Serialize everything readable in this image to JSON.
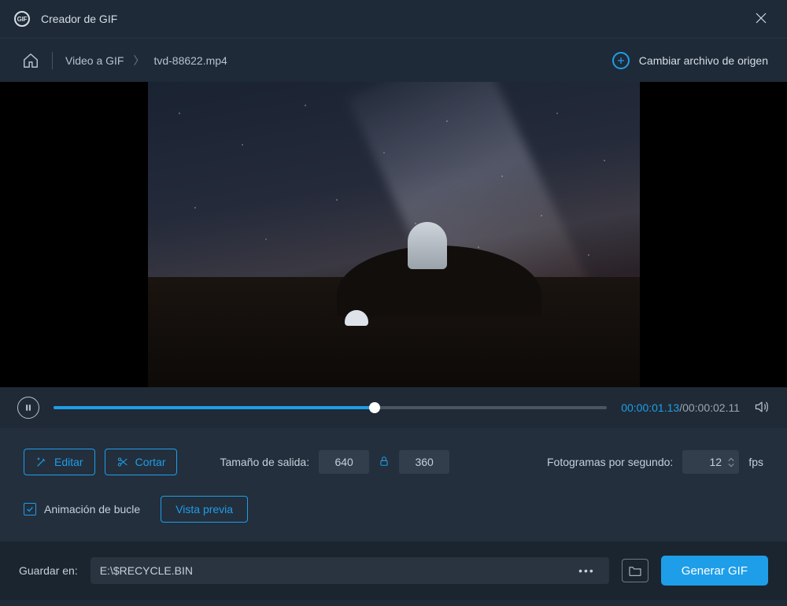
{
  "titlebar": {
    "app_title": "Creador de GIF"
  },
  "breadcrumb": {
    "section": "Video a GIF",
    "filename": "tvd-88622.mp4",
    "change_src": "Cambiar archivo de origen"
  },
  "playbar": {
    "current_time": "00:00:01.13",
    "duration": "00:00:02.11"
  },
  "settings": {
    "edit_label": "Editar",
    "cut_label": "Cortar",
    "size_label": "Tamaño de salida:",
    "width": "640",
    "height": "360",
    "fps_label": "Fotogramas por segundo:",
    "fps_value": "12",
    "fps_unit": "fps",
    "loop_label": "Animación de bucle",
    "preview_label": "Vista previa"
  },
  "savebar": {
    "label": "Guardar en:",
    "path": "E:\\$RECYCLE.BIN",
    "generate": "Generar GIF"
  }
}
